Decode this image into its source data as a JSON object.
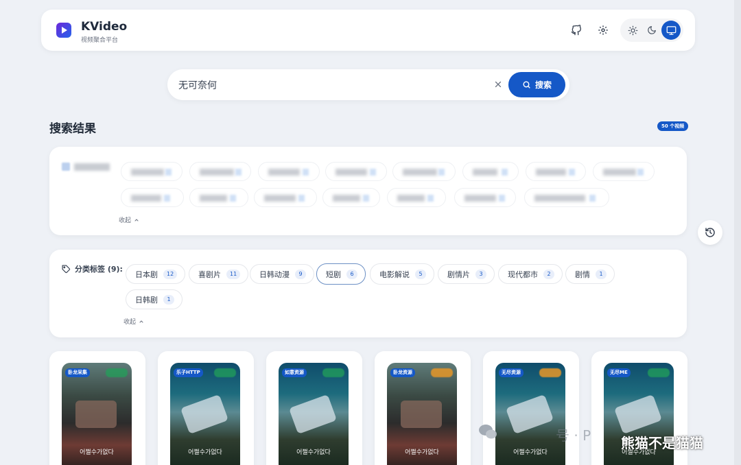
{
  "app": {
    "name": "KVideo",
    "subtitle": "视频聚合平台"
  },
  "header": {
    "github_icon": "github-icon",
    "settings_icon": "gear-icon",
    "theme": {
      "options": [
        "light",
        "dark",
        "system"
      ],
      "selected": "system"
    }
  },
  "search": {
    "value": "无可奈何",
    "button_label": "搜索"
  },
  "results": {
    "title": "搜索结果",
    "count_label": "50 个视频"
  },
  "sources": {
    "collapse_label": "收起"
  },
  "categories": {
    "label": "分类标签 (9):",
    "collapse_label": "收起",
    "selected": "短剧",
    "items": [
      {
        "name": "日本剧",
        "count": "12"
      },
      {
        "name": "喜剧片",
        "count": "11"
      },
      {
        "name": "日韩动漫",
        "count": "9"
      },
      {
        "name": "短剧",
        "count": "6"
      },
      {
        "name": "电影解说",
        "count": "5"
      },
      {
        "name": "剧情片",
        "count": "3"
      },
      {
        "name": "现代都市",
        "count": "2"
      },
      {
        "name": "剧情",
        "count": "1"
      },
      {
        "name": "日韩剧",
        "count": "1"
      }
    ]
  },
  "videos": [
    {
      "source": "卧龙采集",
      "poster": "a",
      "speed_color": "green",
      "caption": "어쩔수가없다"
    },
    {
      "source": "乐子HTTP",
      "poster": "b",
      "speed_color": "green",
      "caption": "어쩔수가없다"
    },
    {
      "source": "如意资源",
      "poster": "b",
      "speed_color": "green",
      "caption": "어쩔수가없다"
    },
    {
      "source": "卧龙资源",
      "poster": "a",
      "speed_color": "orange",
      "caption": "어쩔수가없다"
    },
    {
      "source": "无尽资源",
      "poster": "b",
      "speed_color": "orange",
      "caption": "어쩔수가없다"
    },
    {
      "source": "无尽ME",
      "poster": "b",
      "speed_color": "green",
      "caption": "어쩔수가없다"
    }
  ],
  "watermark": {
    "text": "熊猫不是猫猫",
    "faded": "号 · P"
  },
  "colors": {
    "accent": "#1558c7",
    "background": "#eef1f6"
  }
}
